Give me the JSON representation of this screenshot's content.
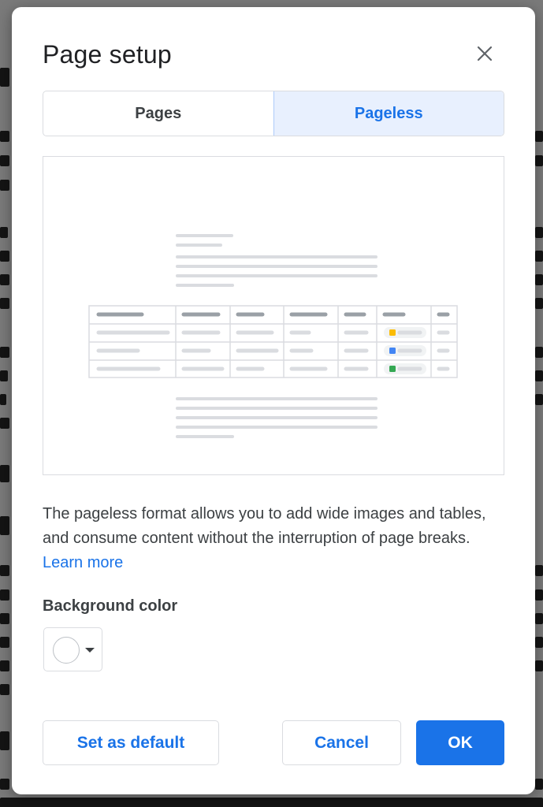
{
  "dialog": {
    "title": "Page setup",
    "close_icon": "close-icon"
  },
  "tabs": [
    {
      "label": "Pages",
      "active": false
    },
    {
      "label": "Pageless",
      "active": true
    }
  ],
  "preview": {
    "status_colors": [
      "#fbbc04",
      "#4285f4",
      "#34a853"
    ]
  },
  "description": {
    "text": "The pageless format allows you to add wide images and tables, and consume content without the interruption of page breaks.",
    "link_label": "Learn more"
  },
  "background_color": {
    "label": "Background color",
    "value": "#ffffff"
  },
  "buttons": {
    "set_default": "Set as default",
    "cancel": "Cancel",
    "ok": "OK"
  },
  "colors": {
    "accent": "#1a73e8",
    "accent_light": "#e8f0fe"
  }
}
